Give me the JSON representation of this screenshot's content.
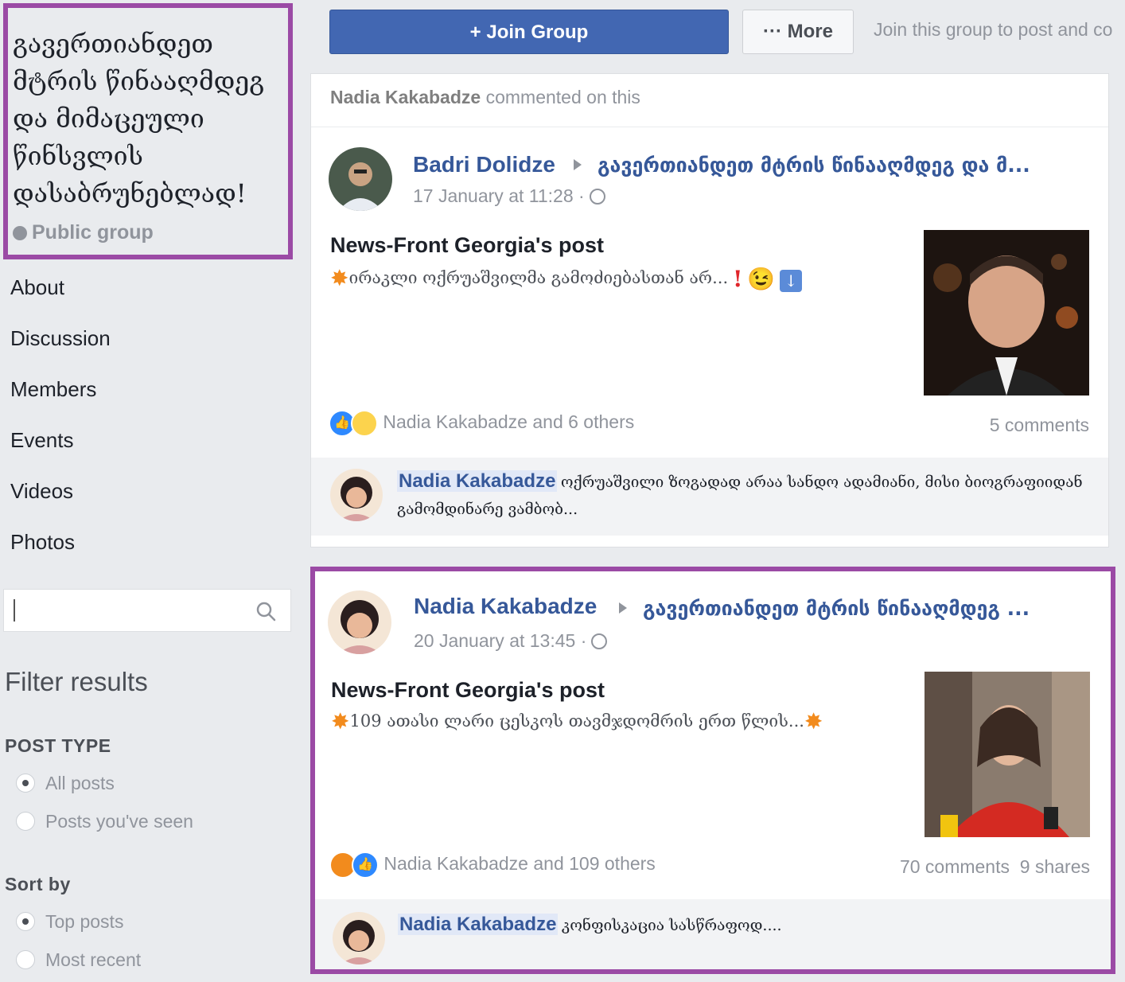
{
  "group": {
    "name": "გავერთიანდეთ მტრის წინააღმდეგ და მიმაცულ წინსვლის დასაბრუნებლად!",
    "name_lines": "გავერთიანდეთ\nმტრის წინააღმდეგ\nდა მიმაცეული\nწინსვლის\nდასაბრუნებლად!",
    "privacy": "Public group"
  },
  "nav": {
    "items": [
      "About",
      "Discussion",
      "Members",
      "Events",
      "Videos",
      "Photos"
    ]
  },
  "search": {
    "value": "",
    "placeholder": ""
  },
  "filter": {
    "title": "Filter results",
    "post_type_label": "POST TYPE",
    "post_type_options": [
      {
        "label": "All posts",
        "selected": true
      },
      {
        "label": "Posts you've seen",
        "selected": false
      }
    ],
    "sort_label": "Sort by",
    "sort_options": [
      {
        "label": "Top posts",
        "selected": true
      },
      {
        "label": "Most recent",
        "selected": false
      }
    ]
  },
  "toolbar": {
    "join_label": "+ Join Group",
    "more_label": "··· More",
    "hint": "Join this group to post and co"
  },
  "posts": [
    {
      "context_user": "Nadia Kakabadze",
      "context_text": " commented on this",
      "author": "Badri Dolidze",
      "group_ref": "გავერთიანდეთ მტრის წინააღმდეგ და მ...",
      "timestamp": "17 January at 11:28 ·",
      "title": "News-Front Georgia's post",
      "text": "ირაკლი ოქრუაშვილმა გამოძიებასთან არ...",
      "reactions_text": "Nadia Kakabadze and 6 others",
      "comments": "5 comments",
      "shares": "",
      "comment_author": "Nadia Kakabadze",
      "comment_text": "ოქრუაშვილი ზოგადად არაა სანდო ადამიანი, მისი ბიოგრაფიიდან გამომდინარე ვამბობ...",
      "icons": [
        "like-icon",
        "haha-icon",
        "globe-icon",
        "exclamation-icon",
        "wink-icon",
        "down-arrow-icon"
      ]
    },
    {
      "author": "Nadia Kakabadze",
      "group_ref": "გავერთიანდეთ მტრის წინააღმდეგ ...",
      "timestamp": "20 January at 13:45 ·",
      "title": "News-Front Georgia's post",
      "text": "109 ათასი ლარი ცესკოს თავმჯდომრის ერთ წლის...",
      "reactions_text": "Nadia Kakabadze and 109 others",
      "comments": "70 comments",
      "shares": "9 shares",
      "comment_author": "Nadia Kakabadze",
      "comment_text": "კონფისკაცია სასწრაფოდ....",
      "icons": [
        "angry-icon",
        "like-icon",
        "globe-icon"
      ]
    }
  ],
  "colors": {
    "accent": "#4267b2",
    "link": "#365899",
    "highlight_border": "#9b4aa5",
    "background": "#e9ebee"
  }
}
